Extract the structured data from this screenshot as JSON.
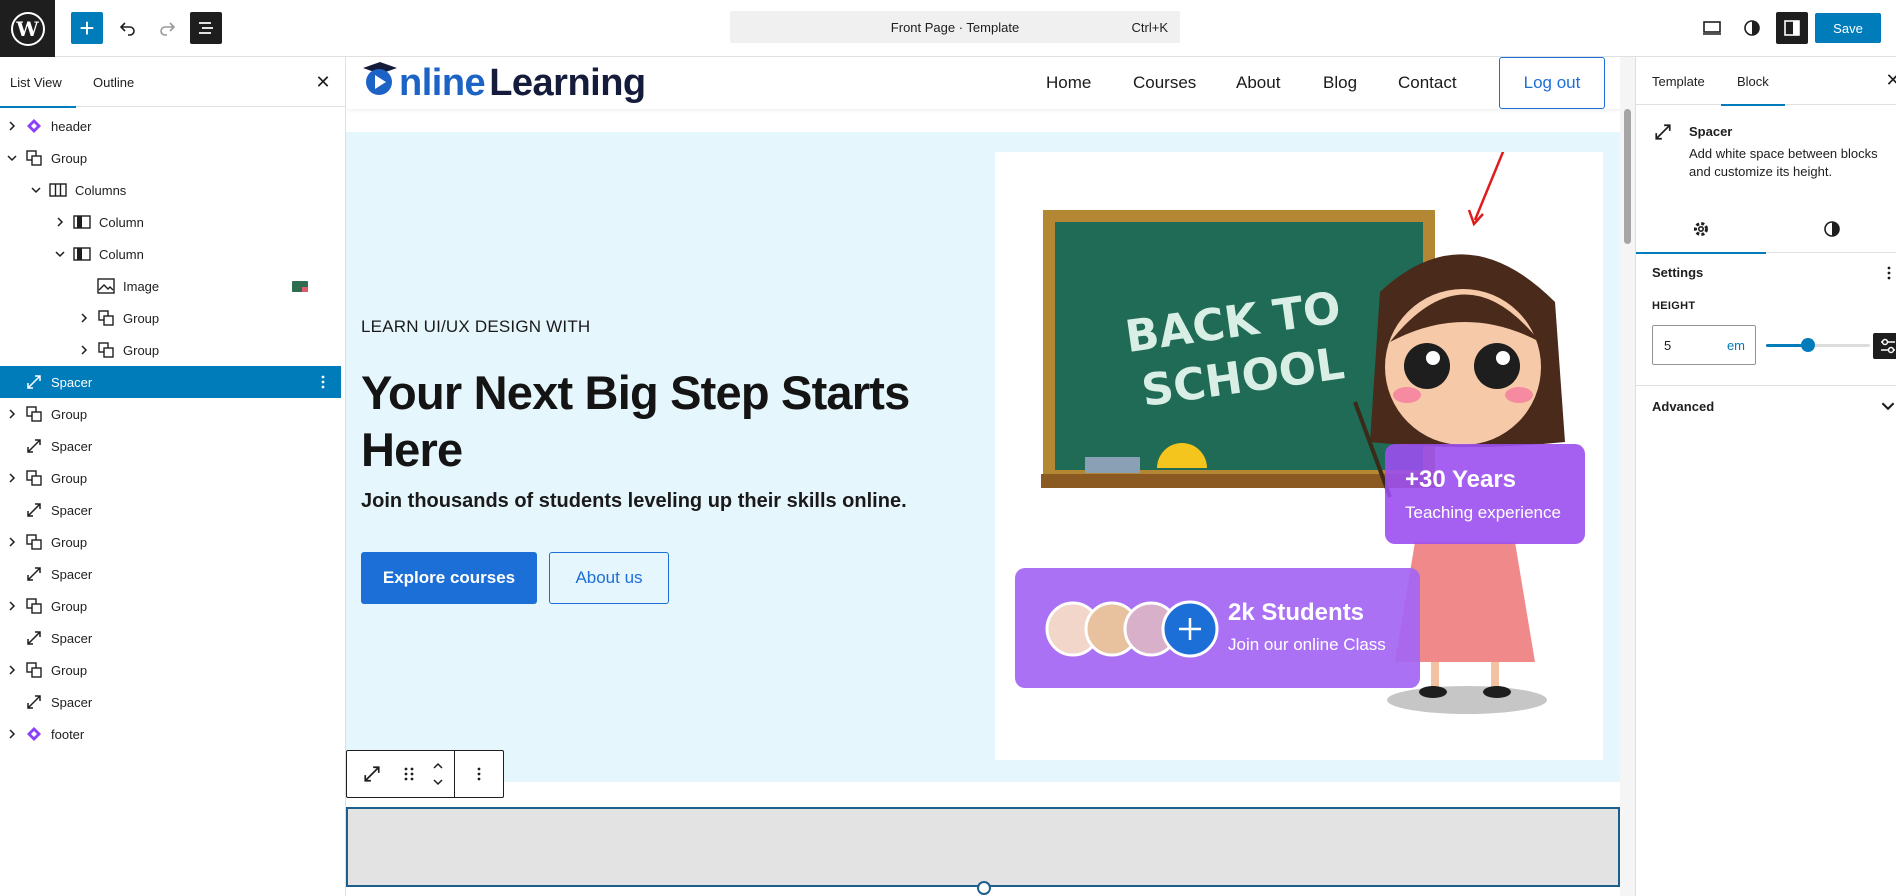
{
  "topbar": {
    "command_title": "Front Page · Template",
    "command_shortcut": "Ctrl+K",
    "save_label": "Save"
  },
  "left_panel": {
    "tabs": [
      "List View",
      "Outline"
    ],
    "items": [
      {
        "label": "header"
      },
      {
        "label": "Group"
      },
      {
        "label": "Columns"
      },
      {
        "label": "Column"
      },
      {
        "label": "Column"
      },
      {
        "label": "Image"
      },
      {
        "label": "Group"
      },
      {
        "label": "Group"
      },
      {
        "label": "Spacer"
      },
      {
        "label": "Group"
      },
      {
        "label": "Spacer"
      },
      {
        "label": "Group"
      },
      {
        "label": "Spacer"
      },
      {
        "label": "Group"
      },
      {
        "label": "Spacer"
      },
      {
        "label": "Group"
      },
      {
        "label": "Spacer"
      },
      {
        "label": "Group"
      },
      {
        "label": "Spacer"
      },
      {
        "label": "footer"
      }
    ]
  },
  "site": {
    "logo_o": "O",
    "logo_first": "nline",
    "logo_second": "Learning",
    "nav": [
      "Home",
      "Courses",
      "About",
      "Blog",
      "Contact"
    ],
    "logout": "Log out"
  },
  "hero": {
    "eyebrow": "LEARN UI/UX DESIGN WITH",
    "title": "Your Next Big Step Starts Here",
    "subtitle": "Join thousands of students leveling up their skills online.",
    "primary_button": "Explore courses",
    "secondary_button": "About us",
    "board_line1": "BACK TO",
    "board_line2": "SCHOOL",
    "badge_years_title": "+30 Years",
    "badge_years_sub": "Teaching experience",
    "badge_students_title": "2k Students",
    "badge_students_sub": "Join our online Class",
    "colors": {
      "accent": "#1d6fd8",
      "hero_bg": "#e6f6fd",
      "board": "#1f6b55",
      "badge": "#9b4ff0"
    }
  },
  "right_panel": {
    "tabs": [
      "Template",
      "Block"
    ],
    "block_title": "Spacer",
    "block_desc": "Add white space between blocks and customize its height.",
    "settings_heading": "Settings",
    "height_label": "HEIGHT",
    "height_value": "5",
    "height_unit": "em",
    "slider_fraction": 0.4,
    "advanced_label": "Advanced"
  }
}
